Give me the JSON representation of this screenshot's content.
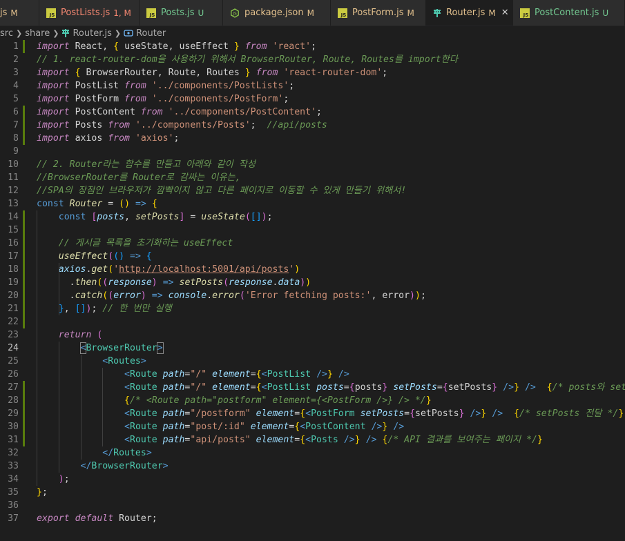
{
  "tabs": [
    {
      "label": "js",
      "status": "M",
      "state": "modified",
      "icon": "js-file-icon",
      "active": false
    },
    {
      "label": "PostLists.js",
      "status": "1, M",
      "state": "error",
      "icon": "js-file-icon",
      "active": false
    },
    {
      "label": "Posts.js",
      "status": "U",
      "state": "untracked",
      "icon": "js-file-icon",
      "active": false
    },
    {
      "label": "package.json",
      "status": "M",
      "state": "modified",
      "icon": "nodejs-file-icon",
      "active": false
    },
    {
      "label": "PostForm.js",
      "status": "M",
      "state": "modified",
      "icon": "js-file-icon",
      "active": false
    },
    {
      "label": "Router.js",
      "status": "M",
      "state": "modified",
      "icon": "router-file-icon",
      "active": true
    },
    {
      "label": "PostContent.js",
      "status": "U",
      "state": "untracked",
      "icon": "js-file-icon",
      "active": false
    }
  ],
  "tab_close": "✕",
  "breadcrumb": [
    "src",
    "share",
    "Router.js",
    "Router"
  ],
  "colors": {
    "background": "#1e1e1e",
    "tab_active": "#1e1e1e",
    "tab_inactive": "#2d2d2d",
    "gutter_modified": "#587c0c",
    "keyword": "#c586c0",
    "string": "#ce9178",
    "comment": "#6a9955"
  },
  "editor": {
    "current_line": 24,
    "modified_lines": [
      1,
      6,
      7,
      8,
      14,
      15,
      16,
      17,
      18,
      19,
      20,
      21,
      22,
      27,
      28,
      29,
      30,
      31
    ],
    "lines": [
      [
        [
          "c-kwi",
          "import"
        ],
        [
          "c-p",
          " React, "
        ],
        [
          "c-br1",
          "{"
        ],
        [
          "c-p",
          " useState, useEffect "
        ],
        [
          "c-br1",
          "}"
        ],
        [
          "c-p",
          " "
        ],
        [
          "c-kwi",
          "from"
        ],
        [
          "c-p",
          " "
        ],
        [
          "c-str",
          "'react'"
        ],
        [
          "c-p",
          ";"
        ]
      ],
      [
        [
          "c-com",
          "// 1. react-router-dom을 사용하기 위해서 BrowserRouter, Route, Routes를 import한다"
        ]
      ],
      [
        [
          "c-kwi",
          "import"
        ],
        [
          "c-p",
          " "
        ],
        [
          "c-br1",
          "{"
        ],
        [
          "c-p",
          " BrowserRouter, Route, Routes "
        ],
        [
          "c-br1",
          "}"
        ],
        [
          "c-p",
          " "
        ],
        [
          "c-kwi",
          "from"
        ],
        [
          "c-p",
          " "
        ],
        [
          "c-str",
          "'react-router-dom'"
        ],
        [
          "c-p",
          ";"
        ]
      ],
      [
        [
          "c-kwi",
          "import"
        ],
        [
          "c-p",
          " PostList "
        ],
        [
          "c-kwi",
          "from"
        ],
        [
          "c-p",
          " "
        ],
        [
          "c-str",
          "'../components/PostLists'"
        ],
        [
          "c-p",
          ";"
        ]
      ],
      [
        [
          "c-kwi",
          "import"
        ],
        [
          "c-p",
          " PostForm "
        ],
        [
          "c-kwi",
          "from"
        ],
        [
          "c-p",
          " "
        ],
        [
          "c-str",
          "'../components/PostForm'"
        ],
        [
          "c-p",
          ";"
        ]
      ],
      [
        [
          "c-kwi",
          "import"
        ],
        [
          "c-p",
          " PostContent "
        ],
        [
          "c-kwi",
          "from"
        ],
        [
          "c-p",
          " "
        ],
        [
          "c-str",
          "'../components/PostContent'"
        ],
        [
          "c-p",
          ";"
        ]
      ],
      [
        [
          "c-kwi",
          "import"
        ],
        [
          "c-p",
          " Posts "
        ],
        [
          "c-kwi",
          "from"
        ],
        [
          "c-p",
          " "
        ],
        [
          "c-str",
          "'../components/Posts'"
        ],
        [
          "c-p",
          ";  "
        ],
        [
          "c-com",
          "//api/posts"
        ]
      ],
      [
        [
          "c-kwi",
          "import"
        ],
        [
          "c-p",
          " axios "
        ],
        [
          "c-kwi",
          "from"
        ],
        [
          "c-p",
          " "
        ],
        [
          "c-str",
          "'axios'"
        ],
        [
          "c-p",
          ";"
        ]
      ],
      [],
      [
        [
          "c-com",
          "// 2. Router라는 함수를 만들고 아래와 같이 작성"
        ]
      ],
      [
        [
          "c-com",
          "//BrowserRouter를 Router로 감싸는 이유는,"
        ]
      ],
      [
        [
          "c-com",
          "//SPA의 장점인 브라우저가 깜빡이지 않고 다른 페이지로 이동할 수 있게 만들기 위해서!"
        ]
      ],
      [
        [
          "c-st",
          "const"
        ],
        [
          "c-p",
          " "
        ],
        [
          "c-fni",
          "Router"
        ],
        [
          "c-p",
          " = "
        ],
        [
          "c-br1",
          "()"
        ],
        [
          "c-p",
          " "
        ],
        [
          "c-st",
          "=>"
        ],
        [
          "c-p",
          " "
        ],
        [
          "c-br1",
          "{"
        ]
      ],
      [
        [
          "c-p",
          "    "
        ],
        [
          "c-st",
          "const"
        ],
        [
          "c-p",
          " "
        ],
        [
          "c-br2",
          "["
        ],
        [
          "c-vari",
          "posts"
        ],
        [
          "c-p",
          ", "
        ],
        [
          "c-fni",
          "setPosts"
        ],
        [
          "c-br2",
          "]"
        ],
        [
          "c-p",
          " = "
        ],
        [
          "c-fni",
          "useState"
        ],
        [
          "c-br2",
          "("
        ],
        [
          "c-br3",
          "[]"
        ],
        [
          "c-br2",
          ")"
        ],
        [
          "c-p",
          ";"
        ]
      ],
      [],
      [
        [
          "c-p",
          "    "
        ],
        [
          "c-com",
          "// 게시글 목록을 초기화하는 useEffect"
        ]
      ],
      [
        [
          "c-p",
          "    "
        ],
        [
          "c-fni",
          "useEffect"
        ],
        [
          "c-br2",
          "("
        ],
        [
          "c-br3",
          "()"
        ],
        [
          "c-p",
          " "
        ],
        [
          "c-st",
          "=>"
        ],
        [
          "c-p",
          " "
        ],
        [
          "c-br3",
          "{"
        ]
      ],
      [
        [
          "c-p",
          "    "
        ],
        [
          "c-vari",
          "axios"
        ],
        [
          "c-p",
          "."
        ],
        [
          "c-fni",
          "get"
        ],
        [
          "c-br1",
          "("
        ],
        [
          "c-str",
          "'"
        ],
        [
          "c-str c-ul",
          "http://localhost:5001/api/posts"
        ],
        [
          "c-str",
          "'"
        ],
        [
          "c-br1",
          ")"
        ]
      ],
      [
        [
          "c-p",
          "      ."
        ],
        [
          "c-fni",
          "then"
        ],
        [
          "c-br1",
          "("
        ],
        [
          "c-br2",
          "("
        ],
        [
          "c-vari",
          "response"
        ],
        [
          "c-br2",
          ")"
        ],
        [
          "c-p",
          " "
        ],
        [
          "c-st",
          "=>"
        ],
        [
          "c-p",
          " "
        ],
        [
          "c-fni",
          "setPosts"
        ],
        [
          "c-br2",
          "("
        ],
        [
          "c-vari",
          "response"
        ],
        [
          "c-p",
          "."
        ],
        [
          "c-vari",
          "data"
        ],
        [
          "c-br2",
          ")"
        ],
        [
          "c-br1",
          ")"
        ]
      ],
      [
        [
          "c-p",
          "      ."
        ],
        [
          "c-fni",
          "catch"
        ],
        [
          "c-br1",
          "("
        ],
        [
          "c-br2",
          "("
        ],
        [
          "c-vari",
          "error"
        ],
        [
          "c-br2",
          ")"
        ],
        [
          "c-p",
          " "
        ],
        [
          "c-st",
          "=>"
        ],
        [
          "c-p",
          " "
        ],
        [
          "c-vari",
          "console"
        ],
        [
          "c-p",
          "."
        ],
        [
          "c-fni",
          "error"
        ],
        [
          "c-br2",
          "("
        ],
        [
          "c-str",
          "'Error fetching posts:'"
        ],
        [
          "c-p",
          ", error"
        ],
        [
          "c-br2",
          ")"
        ],
        [
          "c-br1",
          ")"
        ],
        [
          "c-p",
          ";"
        ]
      ],
      [
        [
          "c-p",
          "    "
        ],
        [
          "c-br3",
          "}"
        ],
        [
          "c-p",
          ", "
        ],
        [
          "c-br3",
          "[]"
        ],
        [
          "c-br2",
          ")"
        ],
        [
          "c-p",
          "; "
        ],
        [
          "c-com",
          "// 한 번만 실행"
        ]
      ],
      [],
      [
        [
          "c-p",
          "    "
        ],
        [
          "c-kwi",
          "return"
        ],
        [
          "c-p",
          " "
        ],
        [
          "c-br2",
          "("
        ]
      ],
      [
        [
          "c-p",
          "        "
        ],
        [
          "c-tag c-box",
          "<"
        ],
        [
          "c-tagn",
          "BrowserRouter"
        ],
        [
          "c-tag c-box",
          ">"
        ]
      ],
      [
        [
          "c-p",
          "            "
        ],
        [
          "c-tag",
          "<"
        ],
        [
          "c-tagn",
          "Routes"
        ],
        [
          "c-tag",
          ">"
        ]
      ],
      [
        [
          "c-p",
          "                "
        ],
        [
          "c-tag",
          "<"
        ],
        [
          "c-tagn",
          "Route"
        ],
        [
          "c-p",
          " "
        ],
        [
          "c-attr",
          "path"
        ],
        [
          "c-p",
          "="
        ],
        [
          "c-str",
          "\"/\""
        ],
        [
          "c-p",
          " "
        ],
        [
          "c-attr",
          "element"
        ],
        [
          "c-p",
          "="
        ],
        [
          "c-br1",
          "{"
        ],
        [
          "c-tag",
          "<"
        ],
        [
          "c-tagn",
          "PostList"
        ],
        [
          "c-p",
          " "
        ],
        [
          "c-tag",
          "/>"
        ],
        [
          "c-br1",
          "}"
        ],
        [
          "c-p",
          " "
        ],
        [
          "c-tag",
          "/>"
        ]
      ],
      [
        [
          "c-p",
          "                "
        ],
        [
          "c-tag",
          "<"
        ],
        [
          "c-tagn",
          "Route"
        ],
        [
          "c-p",
          " "
        ],
        [
          "c-attr",
          "path"
        ],
        [
          "c-p",
          "="
        ],
        [
          "c-str",
          "\"/\""
        ],
        [
          "c-p",
          " "
        ],
        [
          "c-attr",
          "element"
        ],
        [
          "c-p",
          "="
        ],
        [
          "c-br1",
          "{"
        ],
        [
          "c-tag",
          "<"
        ],
        [
          "c-tagn",
          "PostList"
        ],
        [
          "c-p",
          " "
        ],
        [
          "c-attr",
          "posts"
        ],
        [
          "c-p",
          "="
        ],
        [
          "c-br2",
          "{"
        ],
        [
          "c-p",
          "posts"
        ],
        [
          "c-br2",
          "}"
        ],
        [
          "c-p",
          " "
        ],
        [
          "c-attr",
          "setPosts"
        ],
        [
          "c-p",
          "="
        ],
        [
          "c-br2",
          "{"
        ],
        [
          "c-p",
          "setPosts"
        ],
        [
          "c-br2",
          "}"
        ],
        [
          "c-p",
          " "
        ],
        [
          "c-tag",
          "/>"
        ],
        [
          "c-br1",
          "}"
        ],
        [
          "c-p",
          " "
        ],
        [
          "c-tag",
          "/>"
        ],
        [
          "c-p",
          "  "
        ],
        [
          "c-br1",
          "{"
        ],
        [
          "c-com",
          "/* posts와 setPosts"
        ]
      ],
      [
        [
          "c-p",
          "                "
        ],
        [
          "c-br1",
          "{"
        ],
        [
          "c-com",
          "/* <Route path=\"postform\" element={<PostForm />} /> */"
        ],
        [
          "c-br1",
          "}"
        ]
      ],
      [
        [
          "c-p",
          "                "
        ],
        [
          "c-tag",
          "<"
        ],
        [
          "c-tagn",
          "Route"
        ],
        [
          "c-p",
          " "
        ],
        [
          "c-attr",
          "path"
        ],
        [
          "c-p",
          "="
        ],
        [
          "c-str",
          "\"/postform\""
        ],
        [
          "c-p",
          " "
        ],
        [
          "c-attr",
          "element"
        ],
        [
          "c-p",
          "="
        ],
        [
          "c-br1",
          "{"
        ],
        [
          "c-tag",
          "<"
        ],
        [
          "c-tagn",
          "PostForm"
        ],
        [
          "c-p",
          " "
        ],
        [
          "c-attr",
          "setPosts"
        ],
        [
          "c-p",
          "="
        ],
        [
          "c-br2",
          "{"
        ],
        [
          "c-p",
          "setPosts"
        ],
        [
          "c-br2",
          "}"
        ],
        [
          "c-p",
          " "
        ],
        [
          "c-tag",
          "/>"
        ],
        [
          "c-br1",
          "}"
        ],
        [
          "c-p",
          " "
        ],
        [
          "c-tag",
          "/>"
        ],
        [
          "c-p",
          "  "
        ],
        [
          "c-br1",
          "{"
        ],
        [
          "c-com",
          "/* setPosts 전달 */"
        ],
        [
          "c-br1",
          "}"
        ]
      ],
      [
        [
          "c-p",
          "                "
        ],
        [
          "c-tag",
          "<"
        ],
        [
          "c-tagn",
          "Route"
        ],
        [
          "c-p",
          " "
        ],
        [
          "c-attr",
          "path"
        ],
        [
          "c-p",
          "="
        ],
        [
          "c-str",
          "\"post/:id\""
        ],
        [
          "c-p",
          " "
        ],
        [
          "c-attr",
          "element"
        ],
        [
          "c-p",
          "="
        ],
        [
          "c-br1",
          "{"
        ],
        [
          "c-tag",
          "<"
        ],
        [
          "c-tagn",
          "PostContent"
        ],
        [
          "c-p",
          " "
        ],
        [
          "c-tag",
          "/>"
        ],
        [
          "c-br1",
          "}"
        ],
        [
          "c-p",
          " "
        ],
        [
          "c-tag",
          "/>"
        ]
      ],
      [
        [
          "c-p",
          "                "
        ],
        [
          "c-tag",
          "<"
        ],
        [
          "c-tagn",
          "Route"
        ],
        [
          "c-p",
          " "
        ],
        [
          "c-attr",
          "path"
        ],
        [
          "c-p",
          "="
        ],
        [
          "c-str",
          "\"api/posts\""
        ],
        [
          "c-p",
          " "
        ],
        [
          "c-attr",
          "element"
        ],
        [
          "c-p",
          "="
        ],
        [
          "c-br1",
          "{"
        ],
        [
          "c-tag",
          "<"
        ],
        [
          "c-tagn",
          "Posts"
        ],
        [
          "c-p",
          " "
        ],
        [
          "c-tag",
          "/>"
        ],
        [
          "c-br1",
          "}"
        ],
        [
          "c-p",
          " "
        ],
        [
          "c-tag",
          "/>"
        ],
        [
          "c-p",
          " "
        ],
        [
          "c-br1",
          "{"
        ],
        [
          "c-com",
          "/* API 결과를 보여주는 페이지 */"
        ],
        [
          "c-br1",
          "}"
        ]
      ],
      [
        [
          "c-p",
          "            "
        ],
        [
          "c-tag",
          "</"
        ],
        [
          "c-tagn",
          "Routes"
        ],
        [
          "c-tag",
          ">"
        ]
      ],
      [
        [
          "c-p",
          "        "
        ],
        [
          "c-tag",
          "</"
        ],
        [
          "c-tagn",
          "BrowserRouter"
        ],
        [
          "c-tag",
          ">"
        ]
      ],
      [
        [
          "c-p",
          "    "
        ],
        [
          "c-br2",
          ")"
        ],
        [
          "c-p",
          ";"
        ]
      ],
      [
        [
          "c-br1",
          "}"
        ],
        [
          "c-p",
          ";"
        ]
      ],
      [],
      [
        [
          "c-kwi",
          "export"
        ],
        [
          "c-p",
          " "
        ],
        [
          "c-kwi",
          "default"
        ],
        [
          "c-p",
          " Router;"
        ]
      ]
    ]
  }
}
